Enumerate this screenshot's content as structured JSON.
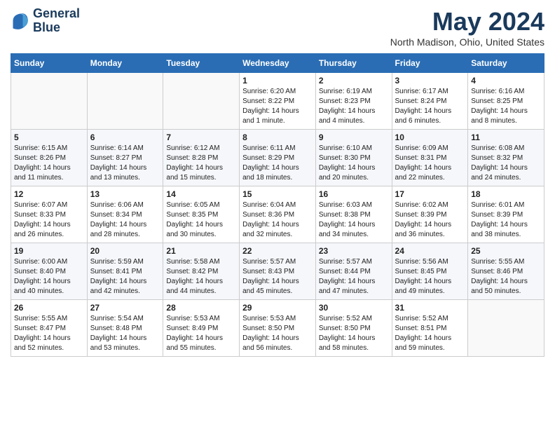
{
  "header": {
    "logo_line1": "General",
    "logo_line2": "Blue",
    "month": "May 2024",
    "location": "North Madison, Ohio, United States"
  },
  "days_of_week": [
    "Sunday",
    "Monday",
    "Tuesday",
    "Wednesday",
    "Thursday",
    "Friday",
    "Saturday"
  ],
  "weeks": [
    [
      {
        "num": "",
        "info": ""
      },
      {
        "num": "",
        "info": ""
      },
      {
        "num": "",
        "info": ""
      },
      {
        "num": "1",
        "info": "Sunrise: 6:20 AM\nSunset: 8:22 PM\nDaylight: 14 hours\nand 1 minute."
      },
      {
        "num": "2",
        "info": "Sunrise: 6:19 AM\nSunset: 8:23 PM\nDaylight: 14 hours\nand 4 minutes."
      },
      {
        "num": "3",
        "info": "Sunrise: 6:17 AM\nSunset: 8:24 PM\nDaylight: 14 hours\nand 6 minutes."
      },
      {
        "num": "4",
        "info": "Sunrise: 6:16 AM\nSunset: 8:25 PM\nDaylight: 14 hours\nand 8 minutes."
      }
    ],
    [
      {
        "num": "5",
        "info": "Sunrise: 6:15 AM\nSunset: 8:26 PM\nDaylight: 14 hours\nand 11 minutes."
      },
      {
        "num": "6",
        "info": "Sunrise: 6:14 AM\nSunset: 8:27 PM\nDaylight: 14 hours\nand 13 minutes."
      },
      {
        "num": "7",
        "info": "Sunrise: 6:12 AM\nSunset: 8:28 PM\nDaylight: 14 hours\nand 15 minutes."
      },
      {
        "num": "8",
        "info": "Sunrise: 6:11 AM\nSunset: 8:29 PM\nDaylight: 14 hours\nand 18 minutes."
      },
      {
        "num": "9",
        "info": "Sunrise: 6:10 AM\nSunset: 8:30 PM\nDaylight: 14 hours\nand 20 minutes."
      },
      {
        "num": "10",
        "info": "Sunrise: 6:09 AM\nSunset: 8:31 PM\nDaylight: 14 hours\nand 22 minutes."
      },
      {
        "num": "11",
        "info": "Sunrise: 6:08 AM\nSunset: 8:32 PM\nDaylight: 14 hours\nand 24 minutes."
      }
    ],
    [
      {
        "num": "12",
        "info": "Sunrise: 6:07 AM\nSunset: 8:33 PM\nDaylight: 14 hours\nand 26 minutes."
      },
      {
        "num": "13",
        "info": "Sunrise: 6:06 AM\nSunset: 8:34 PM\nDaylight: 14 hours\nand 28 minutes."
      },
      {
        "num": "14",
        "info": "Sunrise: 6:05 AM\nSunset: 8:35 PM\nDaylight: 14 hours\nand 30 minutes."
      },
      {
        "num": "15",
        "info": "Sunrise: 6:04 AM\nSunset: 8:36 PM\nDaylight: 14 hours\nand 32 minutes."
      },
      {
        "num": "16",
        "info": "Sunrise: 6:03 AM\nSunset: 8:38 PM\nDaylight: 14 hours\nand 34 minutes."
      },
      {
        "num": "17",
        "info": "Sunrise: 6:02 AM\nSunset: 8:39 PM\nDaylight: 14 hours\nand 36 minutes."
      },
      {
        "num": "18",
        "info": "Sunrise: 6:01 AM\nSunset: 8:39 PM\nDaylight: 14 hours\nand 38 minutes."
      }
    ],
    [
      {
        "num": "19",
        "info": "Sunrise: 6:00 AM\nSunset: 8:40 PM\nDaylight: 14 hours\nand 40 minutes."
      },
      {
        "num": "20",
        "info": "Sunrise: 5:59 AM\nSunset: 8:41 PM\nDaylight: 14 hours\nand 42 minutes."
      },
      {
        "num": "21",
        "info": "Sunrise: 5:58 AM\nSunset: 8:42 PM\nDaylight: 14 hours\nand 44 minutes."
      },
      {
        "num": "22",
        "info": "Sunrise: 5:57 AM\nSunset: 8:43 PM\nDaylight: 14 hours\nand 45 minutes."
      },
      {
        "num": "23",
        "info": "Sunrise: 5:57 AM\nSunset: 8:44 PM\nDaylight: 14 hours\nand 47 minutes."
      },
      {
        "num": "24",
        "info": "Sunrise: 5:56 AM\nSunset: 8:45 PM\nDaylight: 14 hours\nand 49 minutes."
      },
      {
        "num": "25",
        "info": "Sunrise: 5:55 AM\nSunset: 8:46 PM\nDaylight: 14 hours\nand 50 minutes."
      }
    ],
    [
      {
        "num": "26",
        "info": "Sunrise: 5:55 AM\nSunset: 8:47 PM\nDaylight: 14 hours\nand 52 minutes."
      },
      {
        "num": "27",
        "info": "Sunrise: 5:54 AM\nSunset: 8:48 PM\nDaylight: 14 hours\nand 53 minutes."
      },
      {
        "num": "28",
        "info": "Sunrise: 5:53 AM\nSunset: 8:49 PM\nDaylight: 14 hours\nand 55 minutes."
      },
      {
        "num": "29",
        "info": "Sunrise: 5:53 AM\nSunset: 8:50 PM\nDaylight: 14 hours\nand 56 minutes."
      },
      {
        "num": "30",
        "info": "Sunrise: 5:52 AM\nSunset: 8:50 PM\nDaylight: 14 hours\nand 58 minutes."
      },
      {
        "num": "31",
        "info": "Sunrise: 5:52 AM\nSunset: 8:51 PM\nDaylight: 14 hours\nand 59 minutes."
      },
      {
        "num": "",
        "info": ""
      }
    ]
  ]
}
